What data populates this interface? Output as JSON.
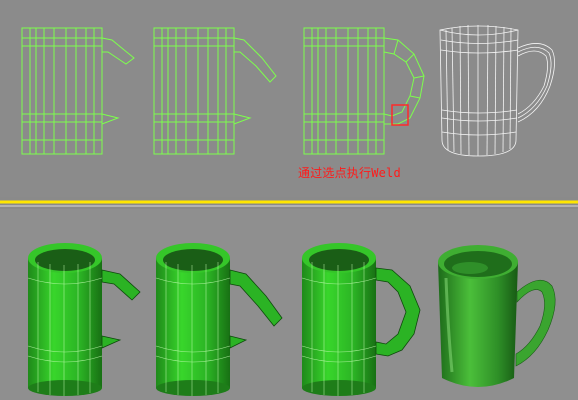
{
  "caption": "通过选点执行Weld",
  "colors": {
    "background_top": "#8b8b8b",
    "background_bottom": "#8f8f8f",
    "wire_green": "#7dff4d",
    "wire_white": "#f5f5f5",
    "highlight_red": "#ff2a2a",
    "divider_yellow": "#ffe600",
    "mug_green": "#4bbf3a"
  },
  "top_row": [
    {
      "name": "mug-wireframe-step-1",
      "style": "green wireframe, short straight handle"
    },
    {
      "name": "mug-wireframe-step-2",
      "style": "green wireframe, bent handle"
    },
    {
      "name": "mug-wireframe-step-3",
      "style": "green wireframe, closed handle with selected vertex"
    },
    {
      "name": "mug-wireframe-final",
      "style": "white wireframe, smoothed"
    }
  ],
  "bottom_row": [
    {
      "name": "mug-shaded-step-1"
    },
    {
      "name": "mug-shaded-step-2"
    },
    {
      "name": "mug-shaded-step-3"
    },
    {
      "name": "mug-shaded-final"
    }
  ]
}
